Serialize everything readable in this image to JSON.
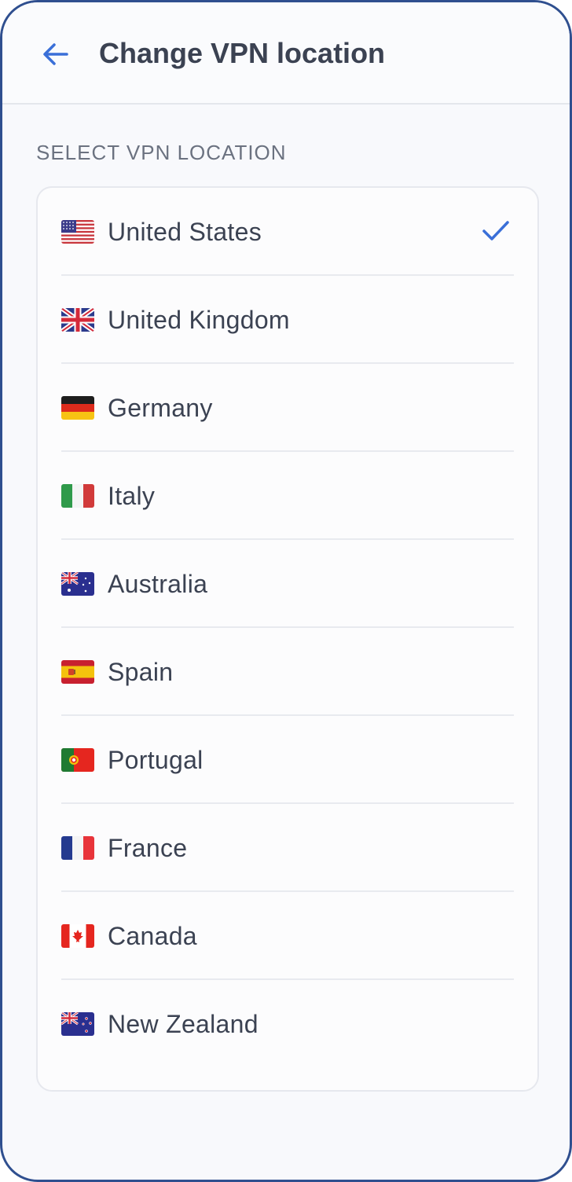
{
  "header": {
    "title": "Change VPN location",
    "back_icon": "arrow-left-icon"
  },
  "section_label": "SELECT VPN LOCATION",
  "accent_color": "#3a6fd8",
  "selected_index": 0,
  "locations": [
    {
      "name": "United States",
      "flag": "us",
      "selected": true
    },
    {
      "name": "United Kingdom",
      "flag": "gb",
      "selected": false
    },
    {
      "name": "Germany",
      "flag": "de",
      "selected": false
    },
    {
      "name": "Italy",
      "flag": "it",
      "selected": false
    },
    {
      "name": "Australia",
      "flag": "au",
      "selected": false
    },
    {
      "name": "Spain",
      "flag": "es",
      "selected": false
    },
    {
      "name": "Portugal",
      "flag": "pt",
      "selected": false
    },
    {
      "name": "France",
      "flag": "fr",
      "selected": false
    },
    {
      "name": "Canada",
      "flag": "ca",
      "selected": false
    },
    {
      "name": "New Zealand",
      "flag": "nz",
      "selected": false
    }
  ]
}
